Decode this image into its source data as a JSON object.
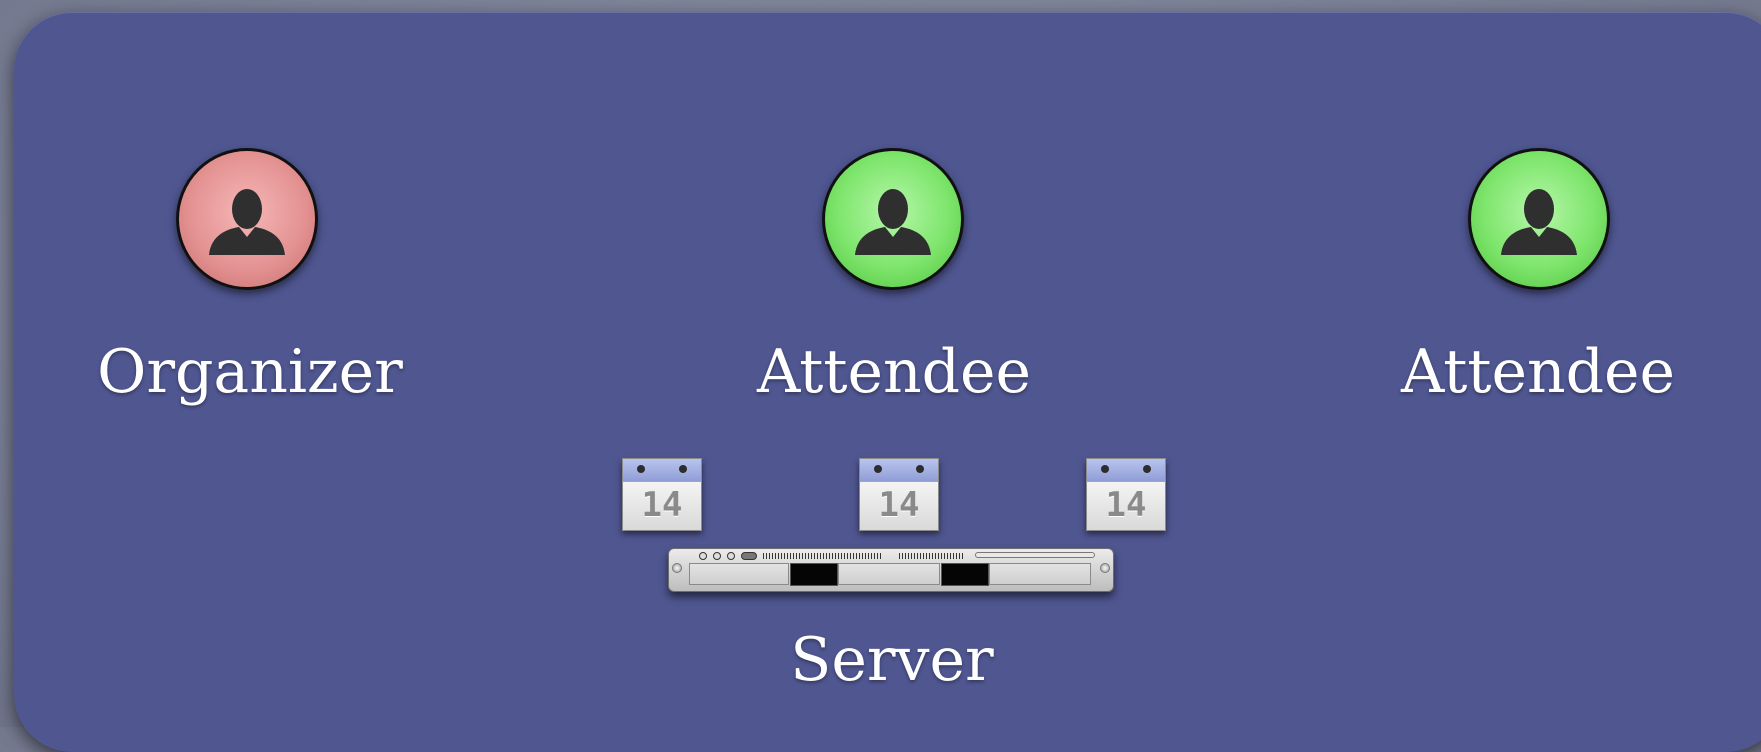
{
  "diagram": {
    "nodes": [
      {
        "id": "organizer",
        "label": "Organizer",
        "icon": "person-icon",
        "color": "#e49393"
      },
      {
        "id": "attendee-1",
        "label": "Attendee",
        "icon": "person-icon",
        "color": "#7ee56c"
      },
      {
        "id": "attendee-2",
        "label": "Attendee",
        "icon": "person-icon",
        "color": "#7ee56c"
      }
    ],
    "calendars": [
      {
        "day": "14",
        "icon": "calendar-icon"
      },
      {
        "day": "14",
        "icon": "calendar-icon"
      },
      {
        "day": "14",
        "icon": "calendar-icon"
      }
    ],
    "server": {
      "label": "Server",
      "icon": "server-rack-icon"
    }
  },
  "colors": {
    "panel": "#4f5690",
    "organizer": "#e49393",
    "attendee": "#7ee56c"
  }
}
